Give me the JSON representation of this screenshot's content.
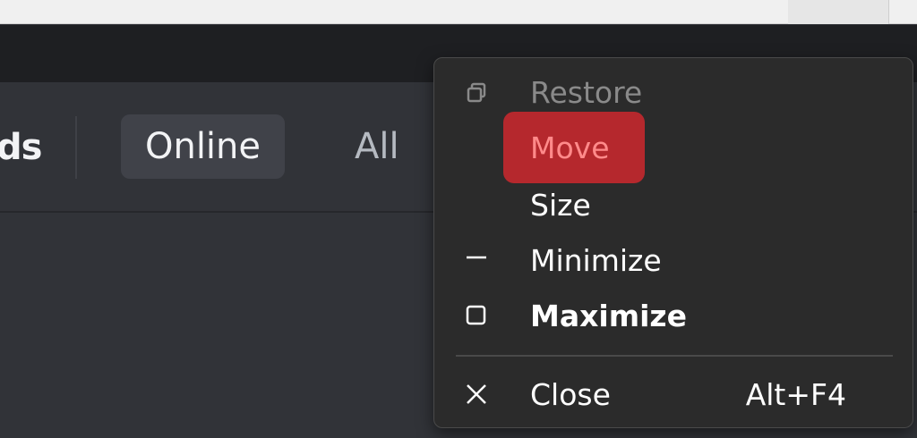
{
  "header": {
    "friends_label": "ds",
    "tabs": [
      {
        "label": "Online",
        "active": true
      },
      {
        "label": "All",
        "active": false
      }
    ]
  },
  "system_menu": {
    "items": [
      {
        "label": "Restore",
        "icon": "restore-icon",
        "state": "disabled"
      },
      {
        "label": "Move",
        "icon": null,
        "state": "highlighted"
      },
      {
        "label": "Size",
        "icon": null,
        "state": "normal"
      },
      {
        "label": "Minimize",
        "icon": "minimize-icon",
        "state": "normal"
      },
      {
        "label": "Maximize",
        "icon": "maximize-icon",
        "state": "default"
      },
      {
        "label": "Close",
        "icon": "close-icon",
        "state": "normal",
        "shortcut": "Alt+F4"
      }
    ]
  },
  "colors": {
    "app_background": "#313338",
    "title_bar": "#1e1f22",
    "menu_background": "#2b2b2b",
    "highlight": "#b5282d",
    "active_tab": "#404249"
  }
}
